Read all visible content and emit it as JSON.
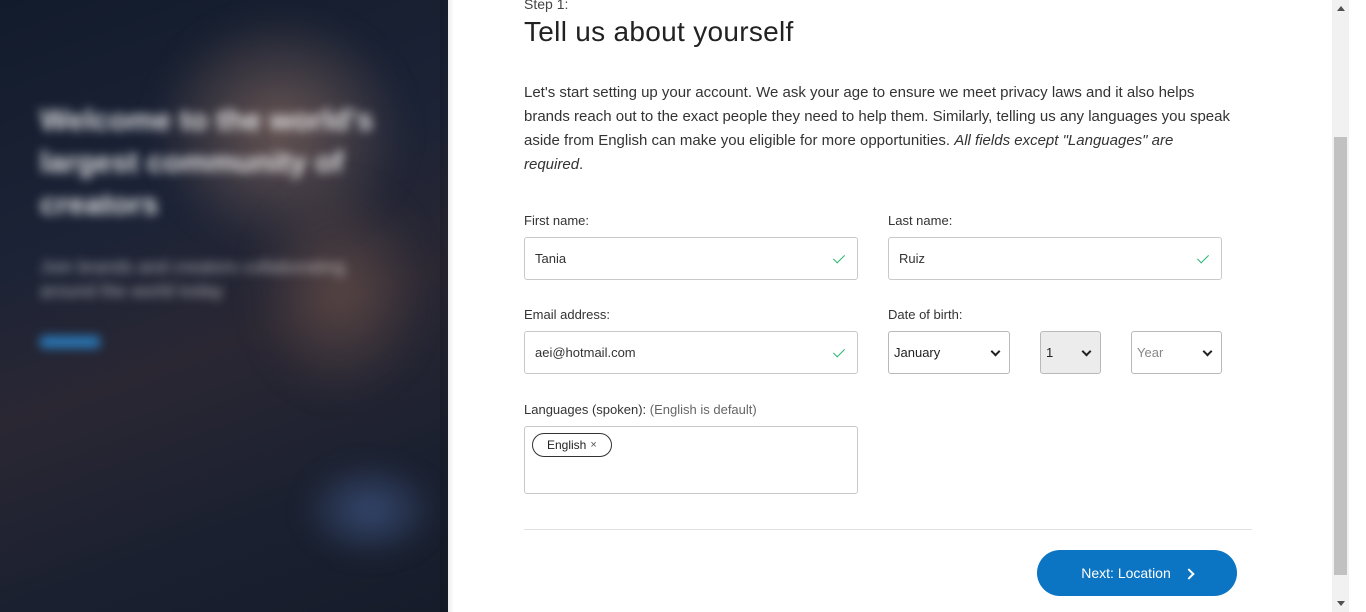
{
  "hero": {
    "headline": "Welcome to the world's largest community of creators",
    "subtext": "Join brands and creators collaborating around the world today",
    "link": "Learn"
  },
  "form": {
    "step": "Step 1:",
    "title": "Tell us about yourself",
    "intro": "Let's start setting up your account. We ask your age to ensure we meet privacy laws and it also helps brands reach out to the exact people they need to help them. Similarly, telling us any languages you speak aside from English can make you eligible for more opportunities. ",
    "intro_emphasis": "All fields except \"Languages\" are required",
    "intro_end": ".",
    "first_name": {
      "label": "First name:",
      "value": "Tania",
      "valid_icon": "check-icon"
    },
    "last_name": {
      "label": "Last name:",
      "value": "Ruiz",
      "valid_icon": "check-icon"
    },
    "email": {
      "label": "Email address:",
      "value": "aei@hotmail.com",
      "valid_icon": "check-icon"
    },
    "dob": {
      "label": "Date of birth:",
      "month": "January",
      "day": "1",
      "year_placeholder": "Year"
    },
    "languages": {
      "label": "Languages (spoken):",
      "hint": "(English is default)",
      "tags": [
        {
          "label": "English",
          "remove": "×"
        }
      ]
    },
    "next_button": {
      "label": "Next: Location",
      "icon": "chevron-right-icon"
    }
  },
  "colors": {
    "primary": "#0b74c3",
    "valid": "#2bb673",
    "border": "#c9c9c9"
  }
}
